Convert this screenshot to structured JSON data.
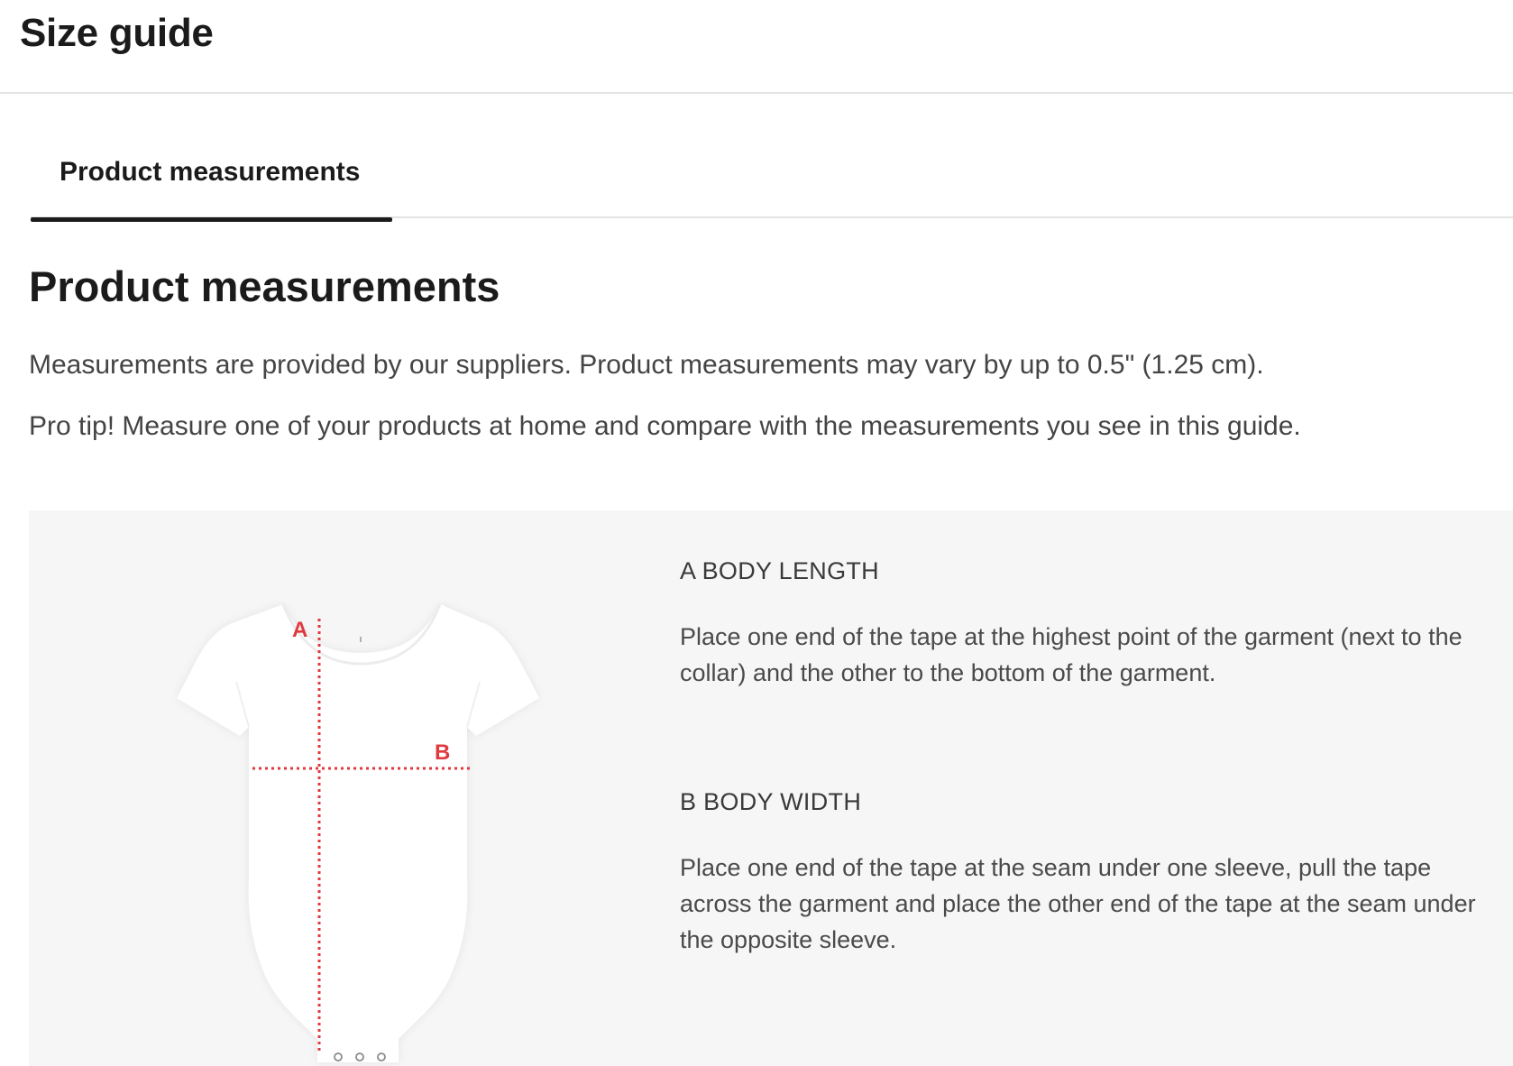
{
  "modal": {
    "title": "Size guide"
  },
  "tabs": [
    {
      "label": "Product measurements",
      "active": true
    }
  ],
  "section": {
    "title": "Product measurements",
    "paragraphs": [
      "Measurements are provided by our suppliers. Product measurements may vary by up to 0.5\" (1.25 cm).",
      "Pro tip! Measure one of your products at home and compare with the measurements you see in this guide."
    ]
  },
  "diagram": {
    "image": "baby-bodysuit-illustration",
    "label_a": "A",
    "label_b": "B",
    "marker_color": "#e0393e"
  },
  "measurements": [
    {
      "title": "A BODY LENGTH",
      "description": "Place one end of the tape at the highest point of the garment (next to the collar) and the other to the bottom of the garment."
    },
    {
      "title": "B BODY WIDTH",
      "description": "Place one end of the tape at the seam under one sleeve, pull the tape across the garment and place the other end of the tape at the seam under the opposite sleeve."
    }
  ]
}
